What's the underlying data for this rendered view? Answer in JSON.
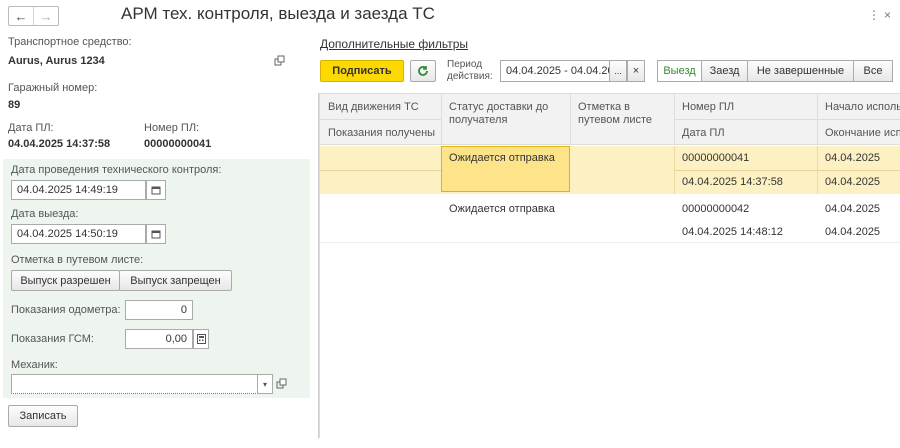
{
  "window": {
    "title": "АРМ тех. контроля, выезда и заезда ТС",
    "nav_back": "←",
    "nav_forward": "→",
    "more": "⋮",
    "close": "×"
  },
  "left": {
    "vehicle_label": "Транспортное средство:",
    "vehicle_value": "Aurus, Aurus 1234",
    "garage_label": "Гаражный номер:",
    "garage_value": "89",
    "pl_date_label": "Дата ПЛ:",
    "pl_date_value": "04.04.2025 14:37:58",
    "pl_number_label": "Номер ПЛ:",
    "pl_number_value": "00000000041",
    "tech_control_label": "Дата проведения технического контроля:",
    "tech_control_value": "04.04.2025 14:49:19",
    "departure_label": "Дата выезда:",
    "departure_value": "04.04.2025 14:50:19",
    "waybill_mark_label": "Отметка в путевом листе:",
    "release_allowed": "Выпуск разрешен",
    "release_denied": "Выпуск запрещен",
    "odometer_label": "Показания одометра:",
    "odometer_value": "0",
    "fuel_label": "Показания ГСМ:",
    "fuel_value": "0,00",
    "mechanic_label": "Механик:",
    "mechanic_value": "",
    "save_button": "Записать"
  },
  "right": {
    "filters_link": "Дополнительные фильтры",
    "sign_button": "Подписать",
    "period_label_1": "Период",
    "period_label_2": "действия:",
    "period_value": "04.04.2025 - 04.04.20",
    "period_pick": "...",
    "period_clear": "×",
    "seg_departure": "Выезд",
    "seg_arrival": "Заезд",
    "seg_unfinished": "Не завершенные",
    "seg_all": "Все"
  },
  "table": {
    "headers": {
      "movement": "Вид движения ТС",
      "readings": "Показания получены",
      "delivery_1": "Статус доставки до",
      "delivery_2": "получателя",
      "mark_1": "Отметка в",
      "mark_2": "путевом листе",
      "pl_number": "Номер ПЛ",
      "pl_date": "Дата ПЛ",
      "start": "Начало исполь",
      "end": "Окончание исп"
    },
    "rows": [
      {
        "status": "Ожидается отправка",
        "pl_number": "00000000041",
        "pl_date": "04.04.2025 14:37:58",
        "start": "04.04.2025",
        "end": "04.04.2025"
      },
      {
        "status": "Ожидается отправка",
        "pl_number": "00000000042",
        "pl_date": "04.04.2025 14:48:12",
        "start": "04.04.2025",
        "end": "04.04.2025"
      }
    ]
  },
  "colors": {
    "accent_yellow": "#fed900",
    "selection": "#fdf0c2",
    "panel_green": "#eef5ee",
    "active_green": "#2e8b2e"
  }
}
